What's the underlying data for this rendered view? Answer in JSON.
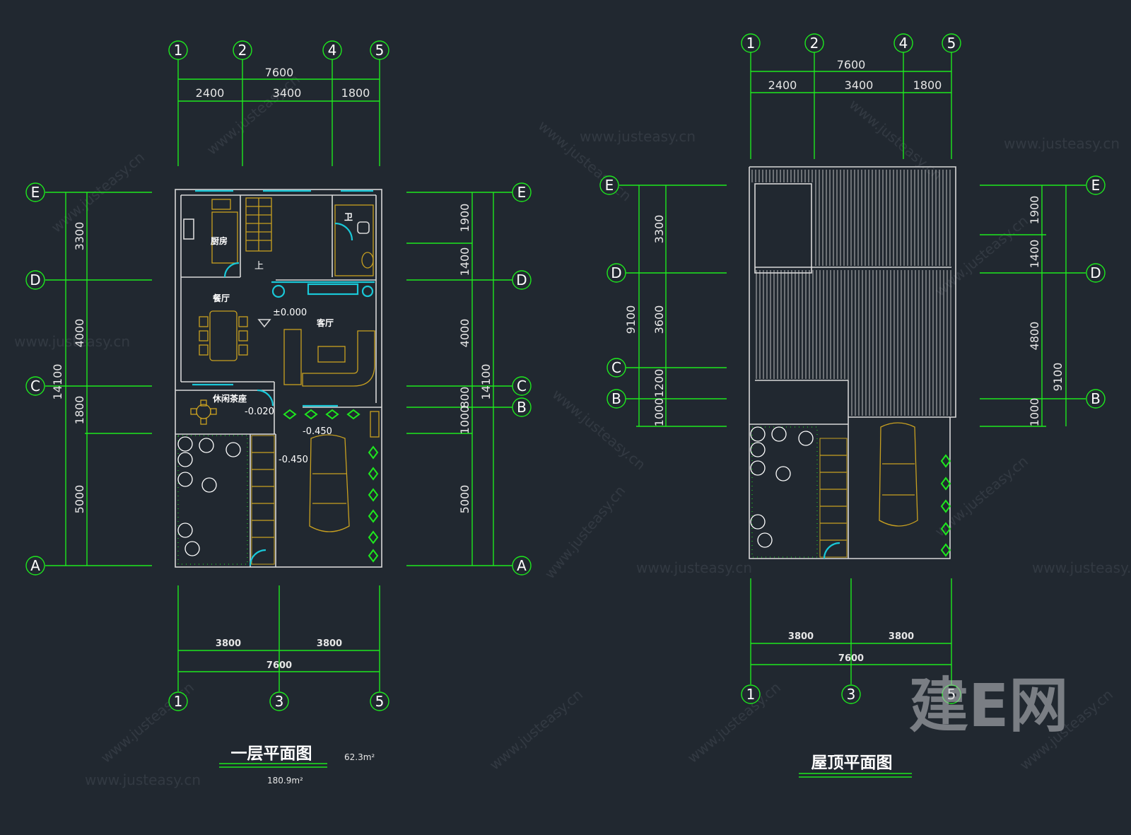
{
  "ground_floor": {
    "title": "一层平面图",
    "area_label": "62.3m²",
    "area_total": "180.9m²",
    "axes_top": [
      "1",
      "2",
      "4",
      "5"
    ],
    "axes_bottom": [
      "1",
      "3",
      "5"
    ],
    "axes_side": [
      "E",
      "D",
      "C",
      "B",
      "A"
    ],
    "dim_total_top": "7600",
    "dims_top": [
      "2400",
      "3400",
      "1800"
    ],
    "dims_bottom": [
      "3800",
      "3800"
    ],
    "dim_total_bottom": "7600",
    "dims_left": [
      "3300",
      "4000",
      "1800",
      "5000"
    ],
    "dim_total_left": "14100",
    "dims_right": [
      "1900",
      "1400",
      "4000",
      "800",
      "1000",
      "5000"
    ],
    "dim_total_right": "14100",
    "rooms": {
      "kitchen": "厨房",
      "dining": "餐厅",
      "living": "客厅",
      "tearoom": "休闲茶座",
      "toilet": "卫"
    },
    "stair_label": "上",
    "levels": [
      "±0.000",
      "-0.020",
      "-0.450",
      "-0.450"
    ]
  },
  "roof": {
    "title": "屋顶平面图",
    "axes_top": [
      "1",
      "2",
      "4",
      "5"
    ],
    "axes_bottom": [
      "1",
      "3",
      "5"
    ],
    "axes_side": [
      "E",
      "D",
      "C",
      "B"
    ],
    "dim_total_top": "7600",
    "dims_top": [
      "2400",
      "3400",
      "1800"
    ],
    "dims_bottom": [
      "3800",
      "3800"
    ],
    "dim_total_bottom": "7600",
    "dims_left": [
      "3300",
      "3600",
      "1200",
      "1000"
    ],
    "dim_total_left": "9100",
    "dims_right": [
      "1900",
      "1400",
      "4800",
      "1000"
    ],
    "dim_total_right": "9100"
  },
  "watermark": {
    "text": "www.justeasy.cn",
    "brand": "建E网"
  },
  "colors": {
    "background": "#212830",
    "axis": "#1ee81e",
    "wall": "#d8d8d8",
    "window": "#19c8d8",
    "furniture": "#c8a020"
  }
}
